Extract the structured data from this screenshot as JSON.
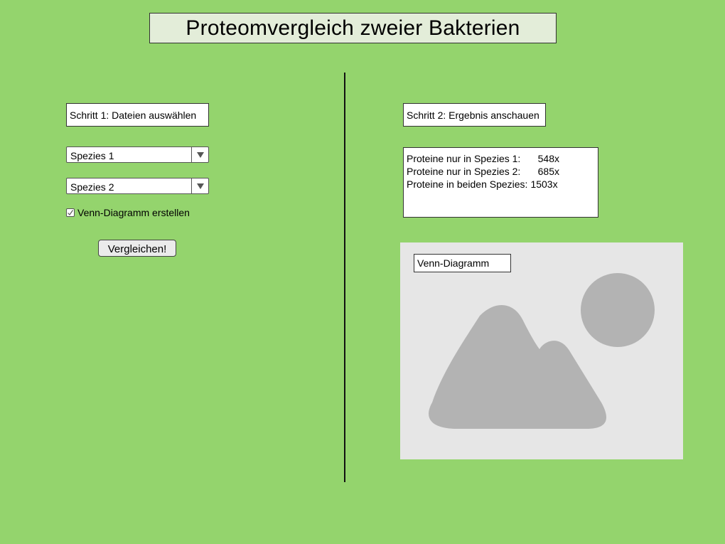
{
  "title": "Proteomvergleich zweier Bakterien",
  "left_panel": {
    "step_label": "Schritt 1: Dateien auswählen",
    "select_species_1": "Spezies 1",
    "select_species_2": "Spezies 2",
    "venn_checkbox": {
      "label": "Venn-Diagramm erstellen",
      "checked": true
    },
    "compare_button": "Vergleichen!"
  },
  "right_panel": {
    "step_label": "Schritt 2: Ergebnis anschauen",
    "results": [
      {
        "label": "Proteine nur in Spezies 1:",
        "value": "548x"
      },
      {
        "label": "Proteine nur in Spezies 2:",
        "value": "685x"
      },
      {
        "label": "Proteine in beiden Spezies:",
        "value": "1503x"
      }
    ],
    "venn_label": "Venn-Diagramm",
    "image_placeholder_icon": "image-placeholder-icon"
  },
  "colors": {
    "background": "#94d46d",
    "title_fill": "#e3edd9",
    "placeholder_bg": "#e6e6e6",
    "placeholder_shape": "#b3b3b3"
  }
}
